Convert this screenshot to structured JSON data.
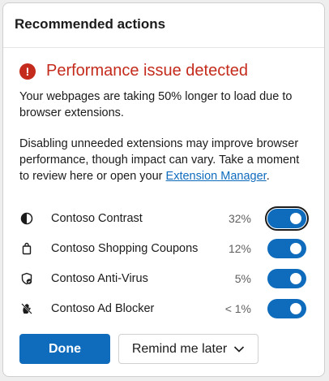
{
  "header": {
    "title": "Recommended actions"
  },
  "alert": {
    "title": "Performance issue detected",
    "message1": "Your webpages are taking 50% longer to load due to browser extensions.",
    "message2_prefix": "Disabling unneeded extensions may improve browser performance, though impact can vary. Take a moment to review here or open your ",
    "link_text": "Extension Manager",
    "message2_suffix": "."
  },
  "extensions": [
    {
      "name": "Contoso Contrast",
      "impact": "32%",
      "enabled": true,
      "icon": "contrast-icon"
    },
    {
      "name": "Contoso Shopping Coupons",
      "impact": "12%",
      "enabled": true,
      "icon": "shopping-bag-icon"
    },
    {
      "name": "Contoso Anti-Virus",
      "impact": "5%",
      "enabled": true,
      "icon": "shield-check-icon"
    },
    {
      "name": "Contoso Ad Blocker",
      "impact": "< 1%",
      "enabled": true,
      "icon": "hand-block-icon"
    }
  ],
  "buttons": {
    "done": "Done",
    "remind": "Remind me later"
  },
  "colors": {
    "accent": "#0f6cbd",
    "danger": "#c42b1c"
  }
}
